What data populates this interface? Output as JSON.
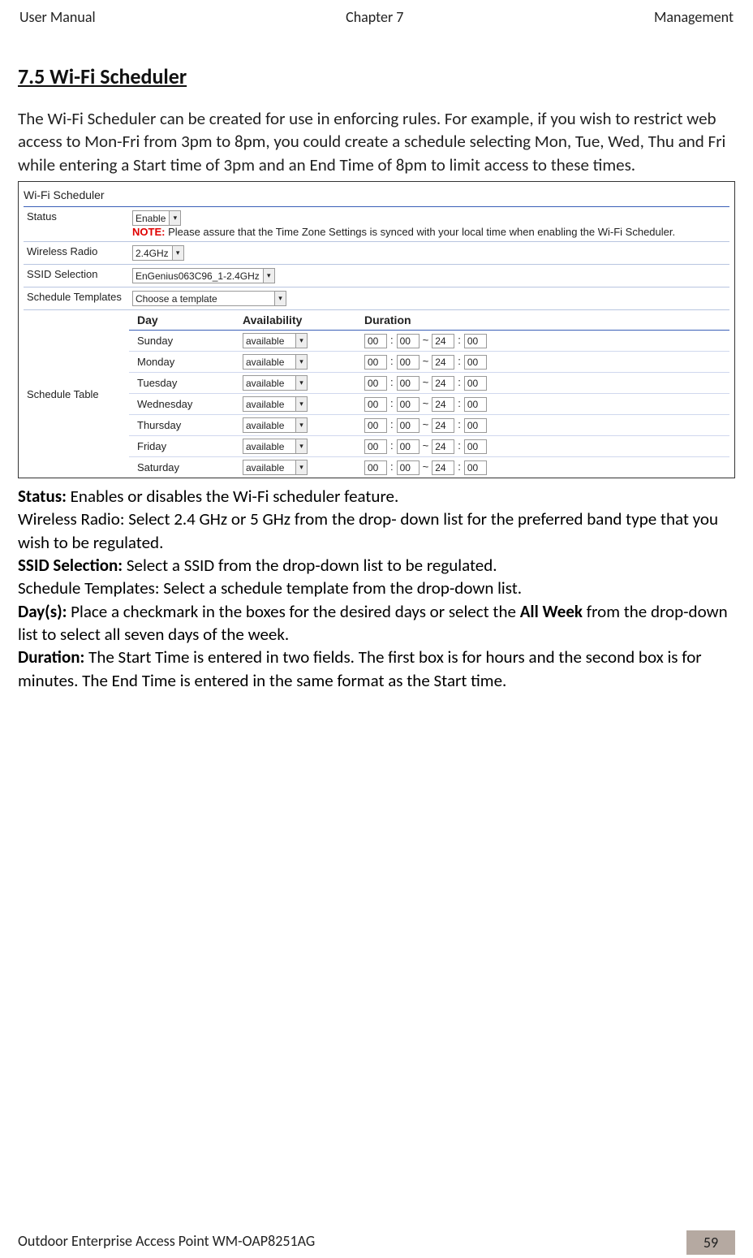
{
  "header": {
    "left": "User Manual",
    "center": "Chapter 7",
    "right": "Management"
  },
  "section_title": "7.5 Wi-Fi Scheduler",
  "intro_text": "The Wi-Fi Scheduler can be created for use in enforcing rules. For example, if you wish to restrict web access to Mon-Fri from 3pm to 8pm, you could create a schedule selecting Mon, Tue, Wed, Thu and Fri while entering a Start time of 3pm and an End Time of 8pm to limit access to these times.",
  "screenshot": {
    "title": "Wi-Fi Scheduler",
    "rows": {
      "status_label": "Status",
      "status_value": "Enable",
      "note_label": "NOTE:",
      "note_text": "  Please assure that the Time Zone Settings is synced with your local time when enabling the Wi-Fi Scheduler.",
      "radio_label": "Wireless Radio",
      "radio_value": "2.4GHz",
      "ssid_label": "SSID Selection",
      "ssid_value": "EnGenius063C96_1-2.4GHz",
      "template_label": "Schedule Templates",
      "template_value": "Choose a template",
      "schedule_label": "Schedule Table"
    },
    "table_headers": {
      "day": "Day",
      "avail": "Availability",
      "dur": "Duration"
    },
    "days": [
      {
        "name": "Sunday",
        "avail": "available",
        "sh": "00",
        "sm": "00",
        "eh": "24",
        "em": "00"
      },
      {
        "name": "Monday",
        "avail": "available",
        "sh": "00",
        "sm": "00",
        "eh": "24",
        "em": "00"
      },
      {
        "name": "Tuesday",
        "avail": "available",
        "sh": "00",
        "sm": "00",
        "eh": "24",
        "em": "00"
      },
      {
        "name": "Wednesday",
        "avail": "available",
        "sh": "00",
        "sm": "00",
        "eh": "24",
        "em": "00"
      },
      {
        "name": "Thursday",
        "avail": "available",
        "sh": "00",
        "sm": "00",
        "eh": "24",
        "em": "00"
      },
      {
        "name": "Friday",
        "avail": "available",
        "sh": "00",
        "sm": "00",
        "eh": "24",
        "em": "00"
      },
      {
        "name": "Saturday",
        "avail": "available",
        "sh": "00",
        "sm": "00",
        "eh": "24",
        "em": "00"
      }
    ]
  },
  "definitions": {
    "status_b": "Status:",
    "status_t": " Enables or disables the Wi-Fi scheduler feature.",
    "radio_t": "Wireless Radio: Select 2.4 GHz or 5 GHz from the drop- down list for the preferred band type that you wish to be regulated.",
    "ssid_b": "SSID Selection:",
    "ssid_t": " Select a SSID from the drop-down list to be regulated.",
    "templates_t": "Schedule Templates: Select a schedule template from the drop-down list.",
    "day_b": "Day(s):",
    "day_t1": " Place a checkmark in the boxes for the desired days or select the ",
    "day_b2": "All Week",
    "day_t2": " from the drop-down list to select all seven days of the week.",
    "dur_b": "Duration:",
    "dur_t": " The Start Time is entered in two fields. The first box is for hours and the second box is for minutes. The End Time is entered in the same format as the Start time."
  },
  "footer": {
    "text": "Outdoor Enterprise Access Point WM-OAP8251AG",
    "page": "59"
  }
}
